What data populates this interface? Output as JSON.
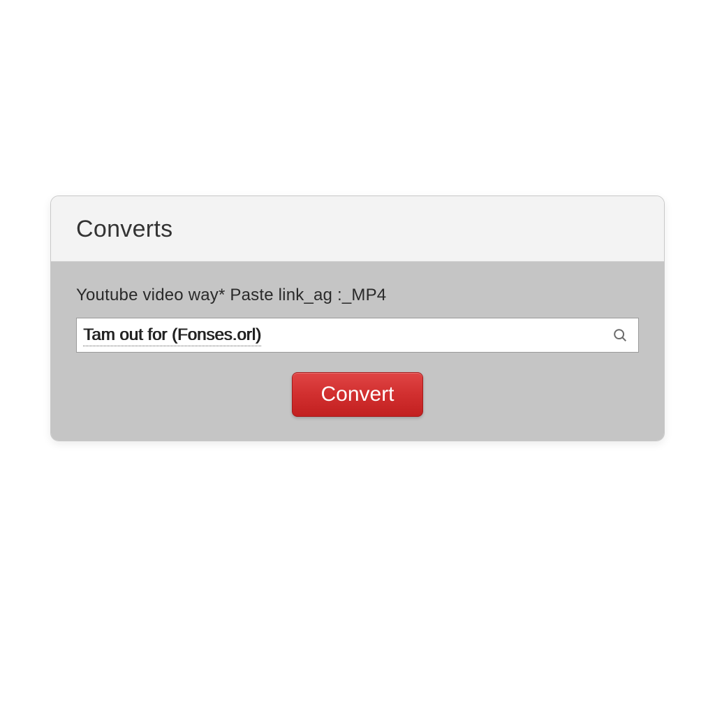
{
  "panel": {
    "title": "Converts",
    "field_label": "Youtube video way* Paste link_ag :_MP4",
    "input_value": "Tam out for (Fonses.orl)",
    "convert_label": "Convert"
  }
}
